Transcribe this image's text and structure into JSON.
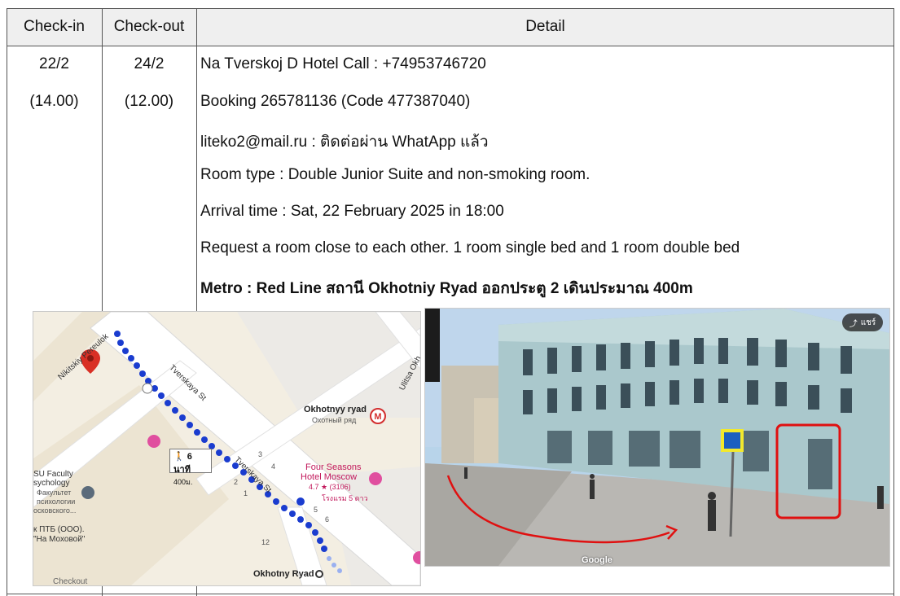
{
  "table": {
    "headers": {
      "checkin": "Check-in",
      "checkout": "Check-out",
      "detail": "Detail"
    },
    "row": {
      "checkin_date": "22/2",
      "checkin_time": "(14.00)",
      "checkout_date": "24/2",
      "checkout_time": "(12.00)",
      "details": [
        "Na Tverskoj D Hotel    Call : +74953746720",
        "Booking 265781136   (Code 477387040)",
        "liteko2@mail.ru : ติดต่อผ่าน WhatApp แล้ว",
        "Room type : Double Junior Suite and non-smoking room.",
        "Arrival time : Sat, 22 February 2025 in 18:00",
        "Request a room close to each other. 1 room single bed and 1 room double bed"
      ],
      "metro": "Metro : Red Line สถานี Okhotniy Ryad ออกประตู 2 เดินประมาณ 400m"
    }
  },
  "map": {
    "street_tverskaya": "Tverskaya St",
    "street_tverskaya2": "Tverskaya St",
    "street_ulitsa": "Ulitsa Okh",
    "street_nikitskiy": "Nikitskiy Pereulok",
    "station_name": "Okhotnyy ryad",
    "station_name_ru": "Охотный ряд",
    "hotel_name": "Four Seasons",
    "hotel_name2": "Hotel Moscow",
    "hotel_rating": "4.7 ★ (3106)",
    "hotel_class": "โรงแรม 5 ดาว",
    "walk_time": "6 นาที",
    "walk_distance": "400ม.",
    "faculty_1": "SU Faculty",
    "faculty_2": "sychology",
    "faculty_3": "Факультет",
    "faculty_4": "психологии",
    "faculty_5": "осковского...",
    "ptb_1": "к ПТБ (ООО).",
    "ptb_2": "\"На Моховой\"",
    "exit_numbers": [
      "3",
      "4",
      "2",
      "1",
      "5",
      "6",
      "12"
    ],
    "bottom_station": "Okhotny Ryad",
    "partial_label": "Checkout",
    "metro_color": "#d32f2f",
    "route_color": "#1a3ccf"
  },
  "photo": {
    "share_label": "แชร์",
    "watermark": "Google",
    "highlight_color": "#e01010"
  }
}
